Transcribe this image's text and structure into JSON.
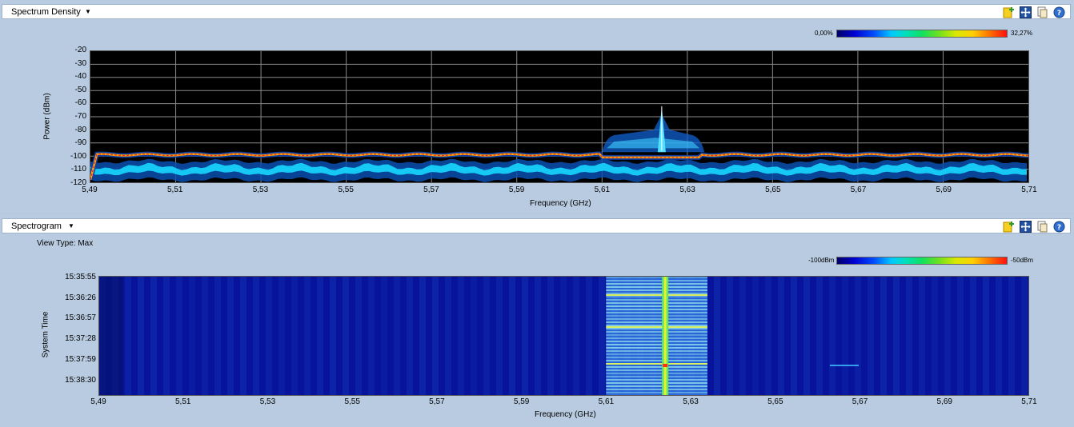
{
  "spectrum": {
    "title": "Spectrum Density",
    "legend": {
      "min": "0,00%",
      "max": "32,27%"
    },
    "y_ticks": [
      "-20",
      "-30",
      "-40",
      "-50",
      "-60",
      "-70",
      "-80",
      "-90",
      "-100",
      "-110",
      "-120"
    ],
    "x_ticks": [
      "5,49",
      "5,51",
      "5,53",
      "5,55",
      "5,57",
      "5,59",
      "5,61",
      "5,63",
      "5,65",
      "5,67",
      "5,69",
      "5,71"
    ],
    "ylabel": "Power (dBm)",
    "xlabel": "Frequency (GHz)"
  },
  "spectrogram": {
    "title": "Spectrogram",
    "view_type": "View Type: Max",
    "legend": {
      "min": "-100dBm",
      "max": "-50dBm"
    },
    "y_ticks": [
      "15:35:55",
      "15:36:26",
      "15:36:57",
      "15:37:28",
      "15:37:59",
      "15:38:30"
    ],
    "x_ticks": [
      "5,49",
      "5,51",
      "5,53",
      "5,55",
      "5,57",
      "5,59",
      "5,61",
      "5,63",
      "5,65",
      "5,67",
      "5,69",
      "5,71"
    ],
    "ylabel": "System Time",
    "xlabel": "Frequency (GHz)"
  },
  "icons": [
    "add-chart-icon",
    "move-icon",
    "copy-icon",
    "help-icon"
  ],
  "colors": {
    "background": "#b8cbe0",
    "plot_bg": "#000000",
    "spectrogram_bg": "#06139a",
    "signal": "#18d8ff"
  }
}
